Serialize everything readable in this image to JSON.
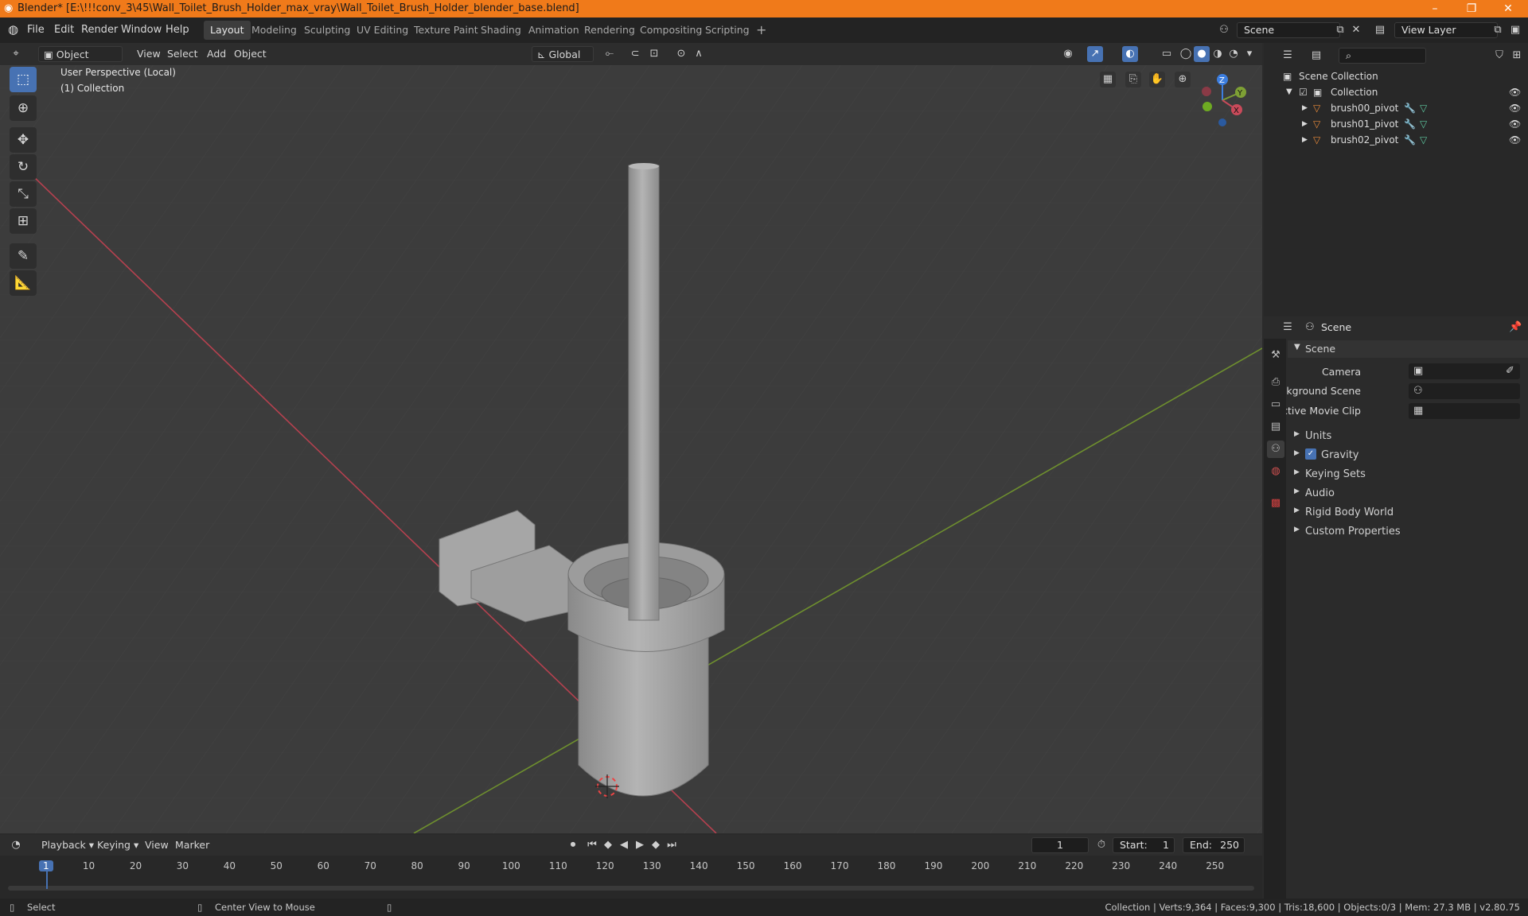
{
  "window": {
    "title": "Blender* [E:\\!!!conv_3\\45\\Wall_Toilet_Brush_Holder_max_vray\\Wall_Toilet_Brush_Holder_blender_base.blend]",
    "minimize": "–",
    "maximize": "❐",
    "close": "✕"
  },
  "menu": [
    "File",
    "Edit",
    "Render",
    "Window",
    "Help"
  ],
  "workspaces": [
    "Layout",
    "Modeling",
    "Sculpting",
    "UV Editing",
    "Texture Paint",
    "Shading",
    "Animation",
    "Rendering",
    "Compositing",
    "Scripting"
  ],
  "workspace_add": "+",
  "scene_field": "Scene",
  "view_layer_field": "View Layer",
  "viewport_header": {
    "mode": "Object Mode",
    "menus": [
      "View",
      "Select",
      "Add",
      "Object"
    ],
    "transform": "Global"
  },
  "viewport": {
    "perspective": "User Perspective (Local)",
    "collection": "(1) Collection",
    "gizmo_axes": {
      "z": "Z",
      "y": "Y",
      "x": "X"
    }
  },
  "outliner": {
    "search_placeholder": "",
    "root": "Scene Collection",
    "collection": "Collection",
    "items": [
      "brush00_pivot",
      "brush01_pivot",
      "brush02_pivot"
    ]
  },
  "properties": {
    "context": "Scene",
    "panel_title": "Scene",
    "fields": [
      {
        "label": "Camera",
        "value": ""
      },
      {
        "label": "Background Scene",
        "value": ""
      },
      {
        "label": "Active Movie Clip",
        "value": ""
      }
    ],
    "sections": [
      "Units",
      "Gravity",
      "Keying Sets",
      "Audio",
      "Rigid Body World",
      "Custom Properties"
    ],
    "gravity_checked": true
  },
  "timeline": {
    "menus": [
      "Playback",
      "Keying",
      "View",
      "Marker"
    ],
    "current_frame": "1",
    "start_label": "Start:",
    "start": "1",
    "end_label": "End:",
    "end": "250",
    "ticks": [
      "1",
      "10",
      "20",
      "30",
      "40",
      "50",
      "60",
      "70",
      "80",
      "90",
      "100",
      "110",
      "120",
      "130",
      "140",
      "150",
      "160",
      "170",
      "180",
      "190",
      "200",
      "210",
      "220",
      "230",
      "240",
      "250"
    ]
  },
  "status": {
    "left": "Select",
    "middle": "Center View to Mouse",
    "right": "Collection | Verts:9,364 | Faces:9,300 | Tris:18,600 | Objects:0/3 | Mem: 27.3 MB | v2.80.75"
  },
  "colors": {
    "title_bar": "#f07a1a",
    "accent": "#4772b3",
    "x_axis": "#c94a5a",
    "y_axis": "#7ea035",
    "z_axis": "#3c7ee0"
  }
}
